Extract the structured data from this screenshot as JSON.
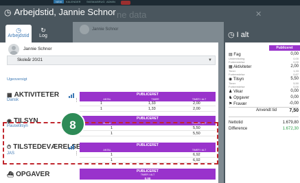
{
  "topbar": {
    "nav": [
      "NEW",
      "KALENDER",
      "SKEMA/BRUG",
      "ADMIN"
    ]
  },
  "header": {
    "title": "Arbejdstid, Jannie Schnor",
    "ghost_suffix": "ne data"
  },
  "background": {
    "name": "Jannie Schnor"
  },
  "tabs": [
    {
      "label": "Arbejdstid",
      "icon": "clock-icon",
      "glyph": "⌚"
    },
    {
      "label": "Log",
      "icon": "refresh-icon",
      "glyph": "↻"
    }
  ],
  "user": {
    "name": "Jannie Schnor"
  },
  "year_select": {
    "value": "Skoleår 20/21"
  },
  "link_ugeoversigt": "Ugeoversigt",
  "sections": {
    "aktiviteter": {
      "title": "AKTIVITETER",
      "icon": "calendar-icon",
      "glyph": "▦",
      "sub": "Dansk",
      "header": "PUBLICERET",
      "cols": [
        "ANTAL",
        "TIMER",
        "TIMER I ALT"
      ],
      "rows": [
        [
          "1",
          "1,33",
          "2,00"
        ],
        [
          "1",
          "1,33",
          "2,00"
        ]
      ]
    },
    "tilsyn": {
      "title": "TILSYN",
      "icon": "eye-icon",
      "glyph": "◉",
      "sub": "Pausetilsyn",
      "header": "PUBLICERET",
      "cols": [
        "ANTAL",
        "TIMER I ALT"
      ],
      "rows": [
        [
          "1",
          "5,50"
        ],
        [
          "1",
          "5,50"
        ]
      ]
    },
    "tilstedevaerelse": {
      "title": "TILSTEDEVÆRELSE",
      "icon": "stopwatch-icon",
      "glyph": "⏱",
      "sub": "JAS",
      "header": "PUBLICERET",
      "cols": [
        "ANTAL",
        "TIMER I ALT"
      ],
      "rows": [
        [
          "1",
          "6,92"
        ],
        [
          "1",
          "6,92"
        ]
      ]
    },
    "opgaver": {
      "title": "OPGAVER",
      "icon": "briefcase-icon",
      "glyph": "⛴",
      "header": "PUBLICERET",
      "cols": [
        "TIMER I ALT"
      ],
      "rows": [
        [
          "0,00"
        ]
      ]
    }
  },
  "step_badge": "8",
  "right_panel": {
    "title": "I alt",
    "header": "Publiceret",
    "rows": [
      {
        "label": "Fag",
        "icon": "book-icon",
        "glyph": "▤",
        "value": "0,00"
      },
      {
        "label": "Aktiviteter",
        "icon": "calendar-icon",
        "glyph": "▦",
        "value": "2,00"
      },
      {
        "label": "Tilsyn",
        "icon": "eye-icon",
        "glyph": "◉",
        "value": "5,50"
      },
      {
        "label": "Vikar",
        "icon": "person-icon",
        "glyph": "♟",
        "value": "0,00"
      },
      {
        "label": "Opgaver",
        "icon": "briefcase-icon",
        "glyph": "♞",
        "value": "0,00"
      },
      {
        "label": "Fravær",
        "icon": "flag-icon",
        "glyph": "⚑",
        "value": "-0,00"
      },
      {
        "label": "Anvendt tid",
        "value": "7,50"
      }
    ],
    "sub_rows": [
      {
        "label": "Undervisning",
        "value": "0,00"
      },
      {
        "label": "Forberedelse",
        "value": "0,00"
      },
      {
        "label": "Timer",
        "value": "1,33"
      },
      {
        "label": "Forberedelse",
        "value": "0,67"
      },
      {
        "label": "Timer",
        "value": "5,50"
      },
      {
        "label": "Forberedelse",
        "value": "0,00"
      }
    ],
    "nettotid_label": "Nettotid",
    "nettotid_value": "1.679,80",
    "difference_label": "Difference",
    "difference_value": "1.672,30",
    "difference_color": "#2a9d46"
  },
  "colors": {
    "accent_purple": "#9933cc",
    "link_blue": "#3c78b4",
    "highlight_red": "#c0262d",
    "badge_green": "#2e8b57"
  }
}
